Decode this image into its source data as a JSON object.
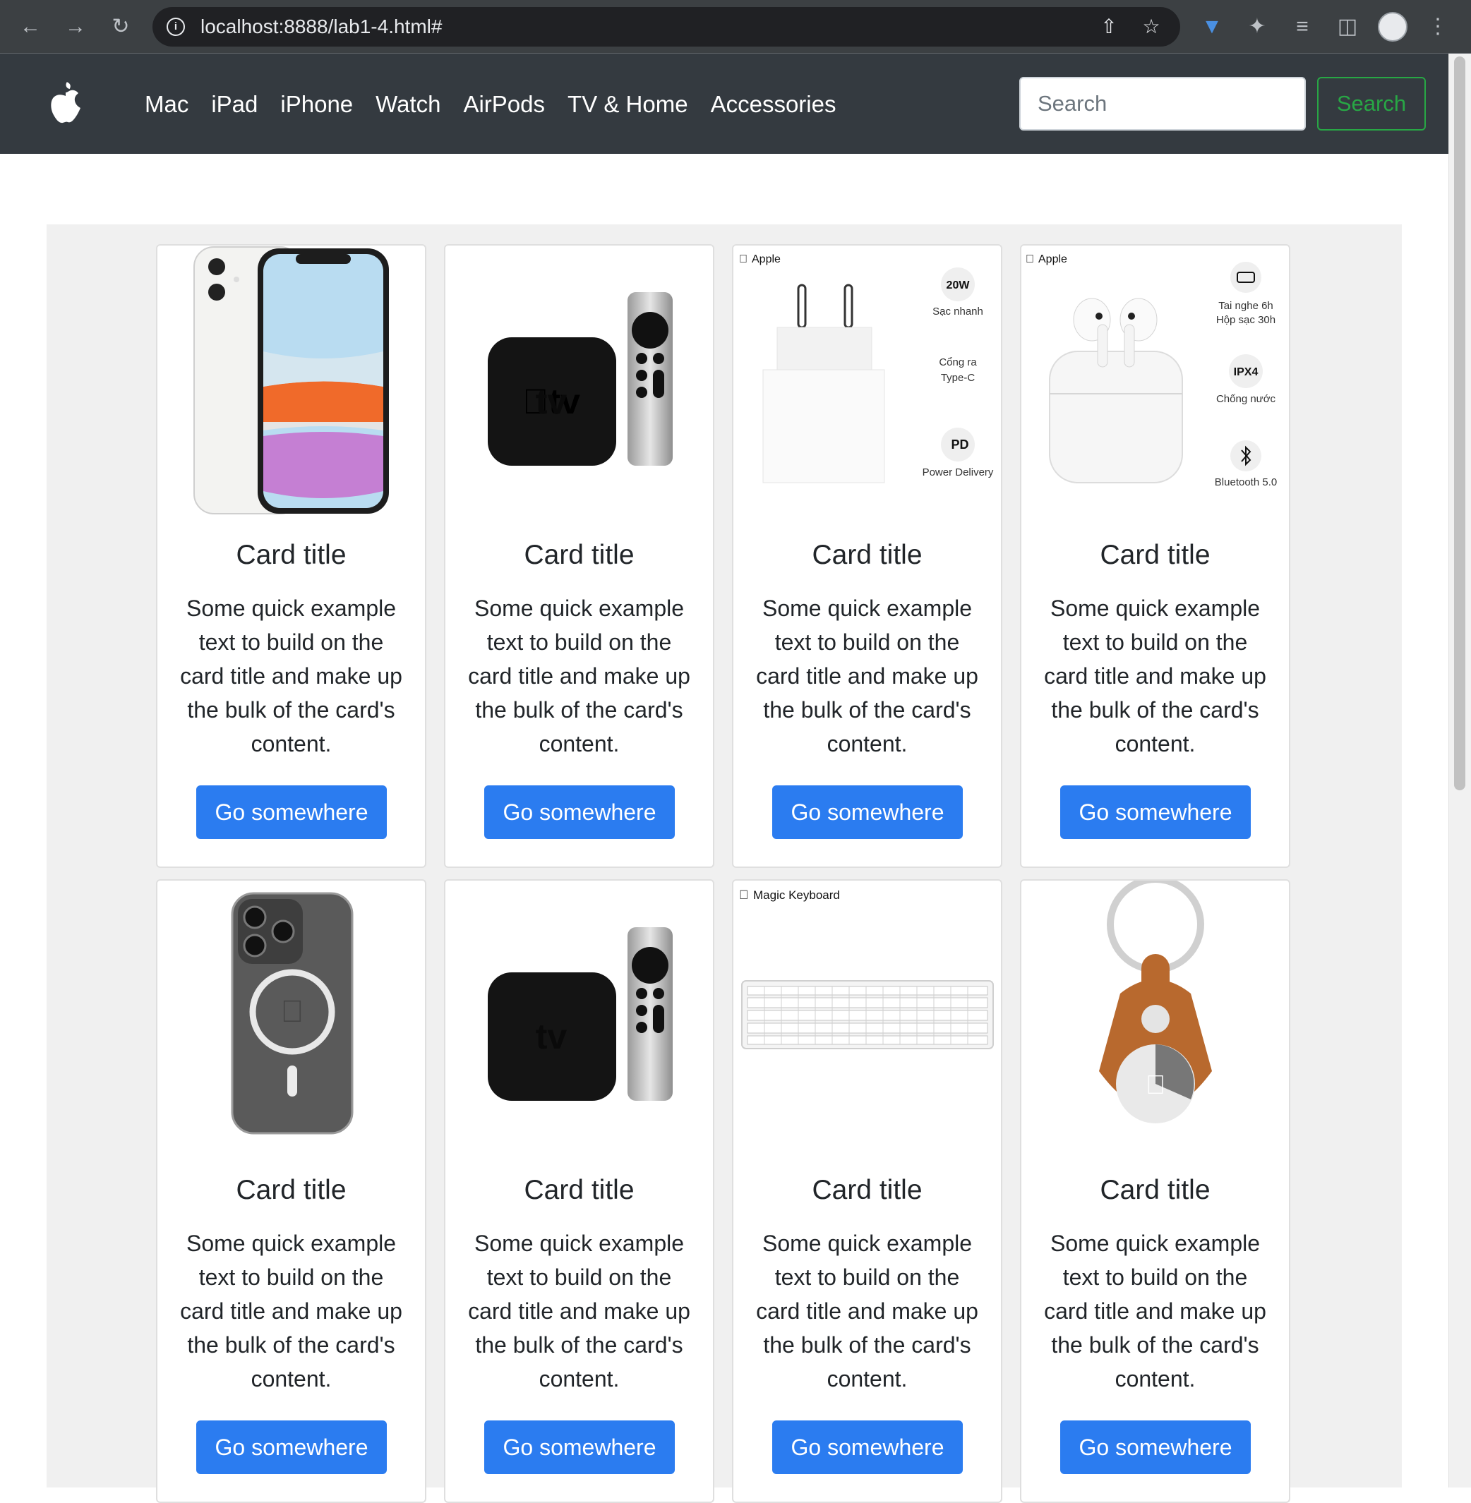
{
  "browser": {
    "url": "localhost:8888/lab1-4.html#",
    "icons": [
      "back-arrow-icon",
      "forward-arrow-icon",
      "reload-icon",
      "site-info-icon",
      "share-icon",
      "bookmark-star-icon",
      "download-extension-icon",
      "extensions-puzzle-icon",
      "reading-list-icon",
      "side-panel-icon",
      "profile-avatar",
      "more-menu-icon"
    ]
  },
  "navbar": {
    "logo": "apple-logo-icon",
    "links": [
      "Mac",
      "iPad",
      "iPhone",
      "Watch",
      "AirPods",
      "TV & Home",
      "Accessories"
    ],
    "search_placeholder": "Search",
    "search_button": "Search",
    "colors": {
      "background": "#343a40",
      "search_accent": "#28a745"
    }
  },
  "cards": [
    {
      "image": "iphone-11-white",
      "title": "Card title",
      "text": "Some quick example text to build on the card title and make up the bulk of the card's content.",
      "button": "Go somewhere"
    },
    {
      "image": "apple-tv-with-remote",
      "title": "Card title",
      "text": "Some quick example text to build on the card title and make up the bulk of the card's content.",
      "button": "Go somewhere"
    },
    {
      "image": "usb-c-power-adapter",
      "image_text": {
        "brand": "Apple",
        "watt": "20W",
        "fast": "Sạc nhanh",
        "port1": "Cổng ra",
        "port2": "Type-C",
        "pd": "PD",
        "pd_label": "Power Delivery"
      },
      "title": "Card title",
      "text": "Some quick example text to build on the card title and make up the bulk of the card's content.",
      "button": "Go somewhere"
    },
    {
      "image": "airpods-3",
      "image_text": {
        "brand": "Apple",
        "battery1": "Tai nghe 6h",
        "battery2": "Hộp sạc 30h",
        "ipx": "IPX4",
        "water": "Chống nước",
        "bt": "Bluetooth 5.0"
      },
      "title": "Card title",
      "text": "Some quick example text to build on the card title and make up the bulk of the card's content.",
      "button": "Go somewhere"
    },
    {
      "image": "iphone-clear-magsafe-case",
      "title": "Card title",
      "text": "Some quick example text to build on the card title and make up the bulk of the card's content.",
      "button": "Go somewhere"
    },
    {
      "image": "apple-tv-with-remote",
      "title": "Card title",
      "text": "Some quick example text to build on the card title and make up the bulk of the card's content.",
      "button": "Go somewhere"
    },
    {
      "image": "magic-keyboard",
      "image_text": {
        "brand": "Magic Keyboard"
      },
      "title": "Card title",
      "text": "Some quick example text to build on the card title and make up the bulk of the card's content.",
      "button": "Go somewhere"
    },
    {
      "image": "airtag-leather-key-ring",
      "title": "Card title",
      "text": "Some quick example text to build on the card title and make up the bulk of the card's content.",
      "button": "Go somewhere"
    }
  ],
  "colors": {
    "button": "#2b7cf0",
    "container": "#f0f0f0"
  }
}
